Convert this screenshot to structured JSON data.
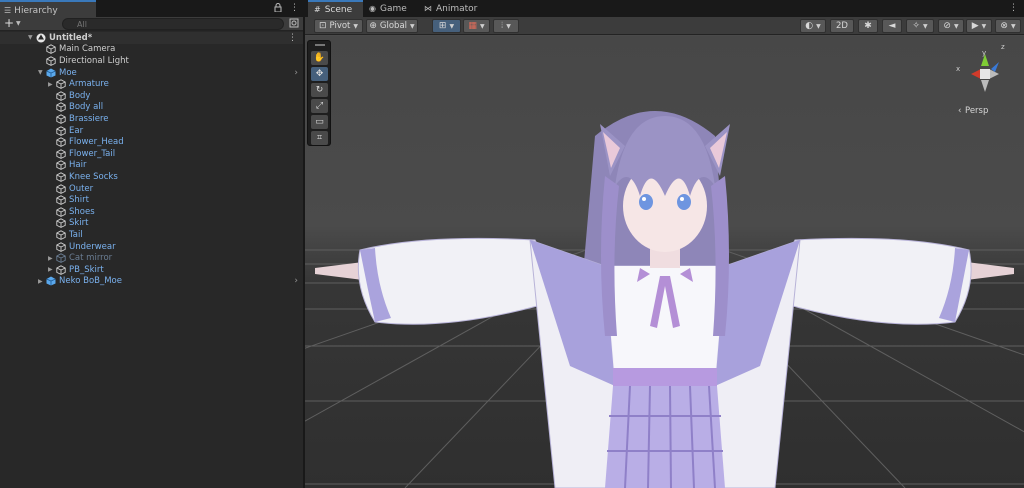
{
  "hierarchy": {
    "tab_label": "Hierarchy",
    "search_placeholder": "All",
    "add_label": "+",
    "rows": [
      {
        "label": "Untitled*",
        "kind": "scene"
      },
      {
        "label": "Main Camera",
        "kind": "object"
      },
      {
        "label": "Directional Light",
        "kind": "object"
      },
      {
        "label": "Moe",
        "kind": "prefab"
      },
      {
        "label": "Armature",
        "kind": "prefab-child"
      },
      {
        "label": "Body",
        "kind": "prefab-child"
      },
      {
        "label": "Body all",
        "kind": "prefab-child"
      },
      {
        "label": "Brassiere",
        "kind": "prefab-child"
      },
      {
        "label": "Ear",
        "kind": "prefab-child"
      },
      {
        "label": "Flower_Head",
        "kind": "prefab-child"
      },
      {
        "label": "Flower_Tail",
        "kind": "prefab-child"
      },
      {
        "label": "Hair",
        "kind": "prefab-child"
      },
      {
        "label": "Knee Socks",
        "kind": "prefab-child"
      },
      {
        "label": "Outer",
        "kind": "prefab-child"
      },
      {
        "label": "Shirt",
        "kind": "prefab-child"
      },
      {
        "label": "Shoes",
        "kind": "prefab-child"
      },
      {
        "label": "Skirt",
        "kind": "prefab-child"
      },
      {
        "label": "Tail",
        "kind": "prefab-child"
      },
      {
        "label": "Underwear",
        "kind": "prefab-child"
      },
      {
        "label": "Cat mirror",
        "kind": "disabled"
      },
      {
        "label": "PB_Skirt",
        "kind": "prefab-child"
      },
      {
        "label": "Neko BoB_Moe",
        "kind": "prefab"
      }
    ]
  },
  "scene": {
    "tabs": [
      {
        "label": "Scene",
        "icon": "scene-grid-icon"
      },
      {
        "label": "Game",
        "icon": "gamepad-icon"
      },
      {
        "label": "Animator",
        "icon": "animator-icon"
      }
    ],
    "toolbar": {
      "pivot_label": "Pivot",
      "global_label": "Global",
      "mode_2d_label": "2D"
    },
    "tools": [
      "hand-tool-icon",
      "move-tool-icon",
      "rotate-tool-icon",
      "scale-tool-icon",
      "rect-tool-icon",
      "transform-tool-icon"
    ],
    "gizmo": {
      "projection_label": "Persp",
      "axis_x": "x",
      "axis_y": "y",
      "axis_z": "z"
    }
  },
  "colors": {
    "accent_tab": "#3a79bb",
    "prefab_text": "#7ab1ee",
    "gizmo_x": "#d13b2b",
    "gizmo_y": "#7fcd35",
    "gizmo_z": "#3a79d6"
  }
}
